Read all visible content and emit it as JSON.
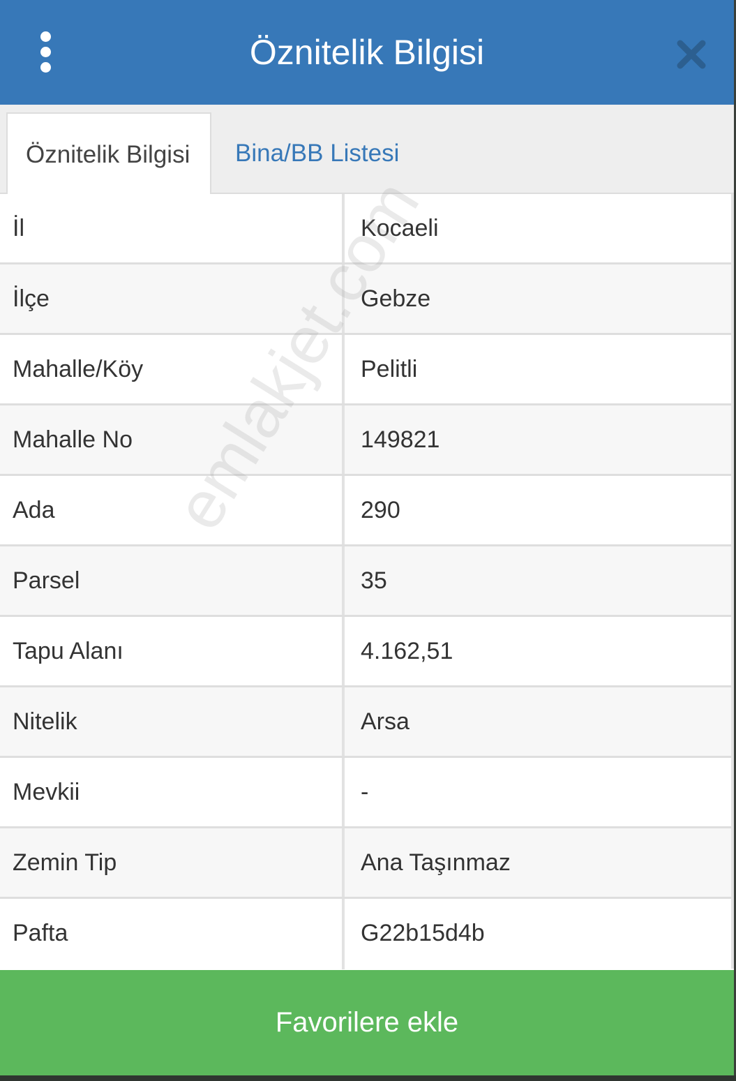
{
  "header": {
    "title": "Öznitelik Bilgisi",
    "menu_icon": "more-vertical-icon",
    "close_icon": "close-icon",
    "color": "#3778b8"
  },
  "tabs": [
    {
      "label": "Öznitelik Bilgisi",
      "active": true
    },
    {
      "label": "Bina/BB Listesi",
      "active": false
    }
  ],
  "attributes": [
    {
      "label": "İl",
      "value": "Kocaeli"
    },
    {
      "label": "İlçe",
      "value": "Gebze"
    },
    {
      "label": "Mahalle/Köy",
      "value": "Pelitli"
    },
    {
      "label": "Mahalle No",
      "value": "149821"
    },
    {
      "label": "Ada",
      "value": "290"
    },
    {
      "label": "Parsel",
      "value": "35"
    },
    {
      "label": "Tapu Alanı",
      "value": "4.162,51"
    },
    {
      "label": "Nitelik",
      "value": "Arsa"
    },
    {
      "label": "Mevkii",
      "value": "-"
    },
    {
      "label": "Zemin Tip",
      "value": "Ana Taşınmaz"
    },
    {
      "label": "Pafta",
      "value": "G22b15d4b"
    }
  ],
  "watermark": "emlakjet.com",
  "footer": {
    "favorite_label": "Favorilere ekle",
    "color": "#5cb85c"
  }
}
